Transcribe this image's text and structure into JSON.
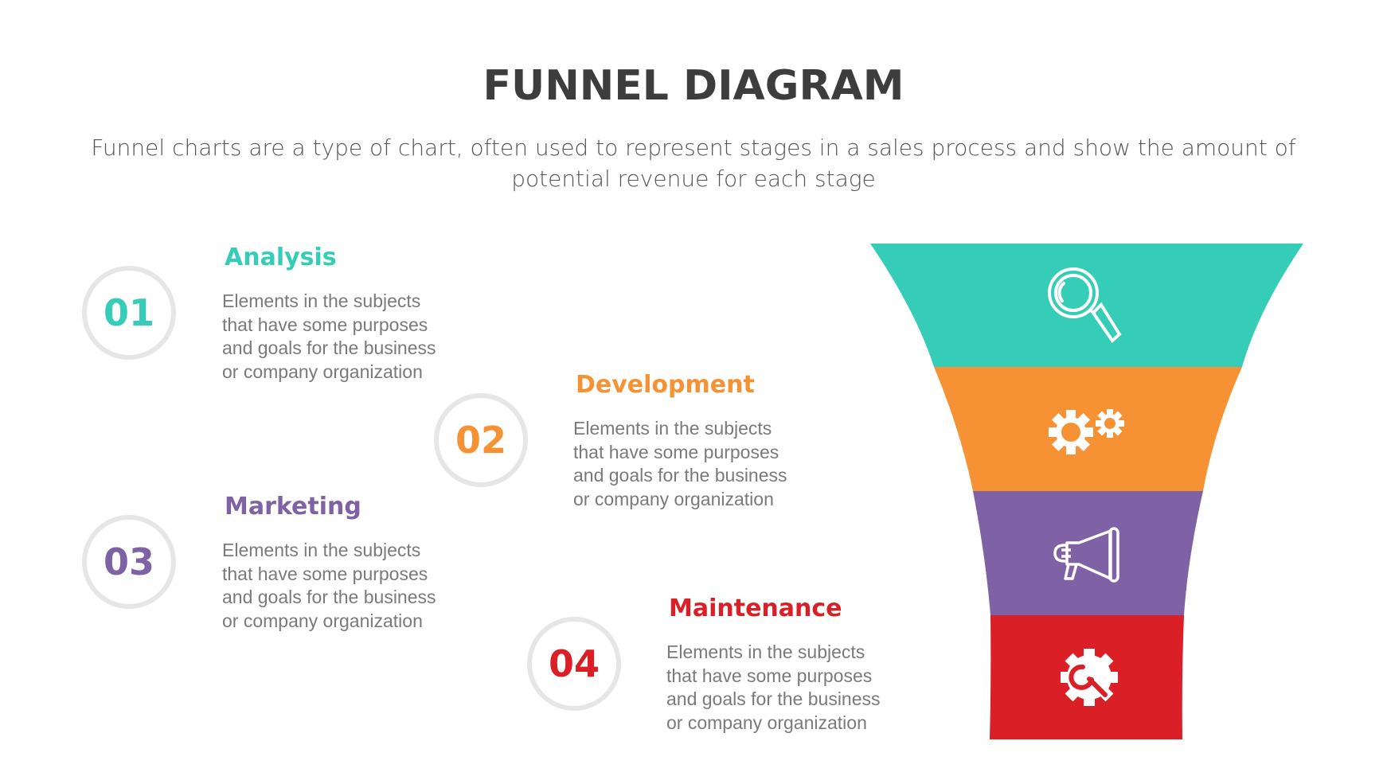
{
  "header": {
    "title": "FUNNEL DIAGRAM",
    "subtitle": "Funnel charts are a type of chart, often used to represent stages in a sales process and show the amount of potential revenue for each stage"
  },
  "stages": [
    {
      "number": "01",
      "title": "Analysis",
      "description": "Elements in the subjects\nthat have some purposes\nand goals for the  business\nor company organization",
      "color": "#35cdb8",
      "icon": "magnifier-icon"
    },
    {
      "number": "02",
      "title": "Development",
      "description": "Elements in the subjects\nthat have some purposes\nand goals for the  business\nor company organization",
      "color": "#f79234",
      "icon": "gears-icon"
    },
    {
      "number": "03",
      "title": "Marketing",
      "description": "Elements in the subjects\nthat have some purposes\nand goals for the  business\nor company organization",
      "color": "#7f61a6",
      "icon": "megaphone-icon"
    },
    {
      "number": "04",
      "title": "Maintenance",
      "description": "Elements in the subjects\nthat have some purposes\nand goals for the  business\nor company organization",
      "color": "#da1f26",
      "icon": "gear-wrench-icon"
    }
  ],
  "colors": {
    "title": "#3d3d3d",
    "subtitle": "#555555",
    "description": "#7a7a7a",
    "circle_border": "#e6e6e6"
  }
}
